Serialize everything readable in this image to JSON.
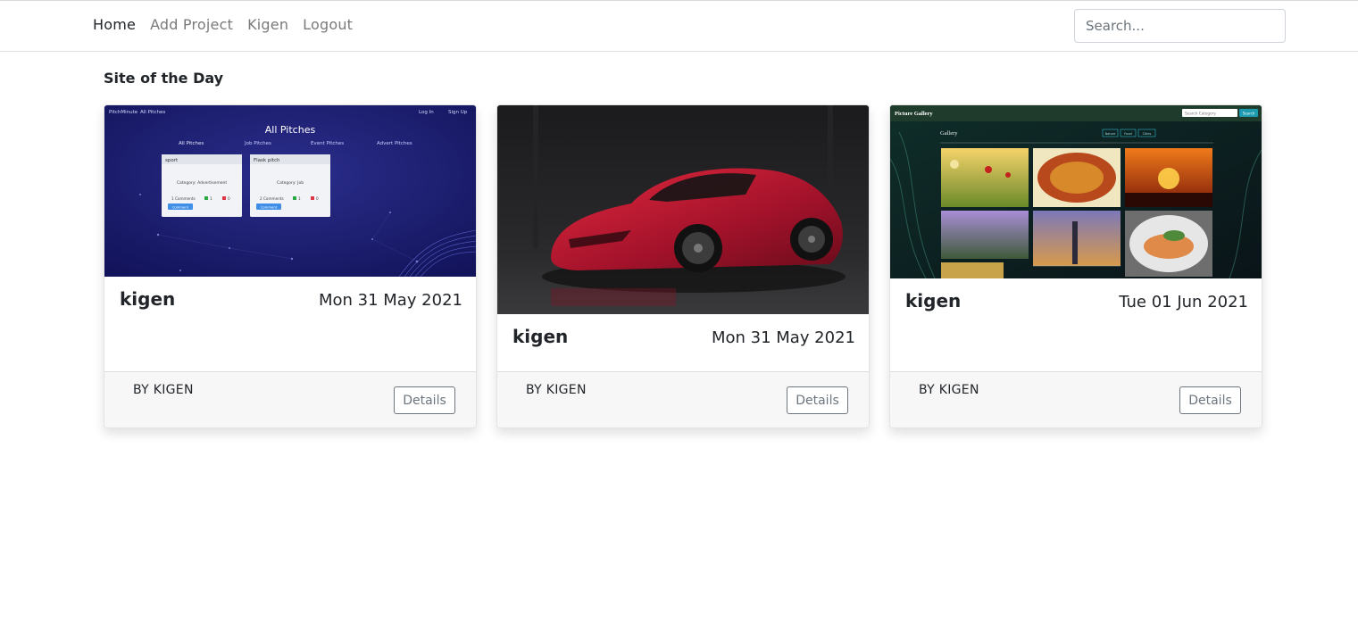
{
  "nav": {
    "links": [
      "Home",
      "Add Project",
      "Kigen",
      "Logout"
    ],
    "search_placeholder": "Search..."
  },
  "section_title": "Site of the Day",
  "cards": [
    {
      "title": "kigen",
      "date": "Mon 31 May 2021",
      "byline": "BY KIGEN",
      "button": "Details",
      "screenshot": {
        "brand": "PitchMinute",
        "menu": "All Pitches",
        "login": "Log In",
        "signup": "Sign Up",
        "heading": "All Pitches",
        "tabs": [
          "All Pitches",
          "Job Pitches",
          "Event Pitches",
          "Advert Pitches"
        ],
        "pitches": [
          {
            "title": "sport",
            "category": "Category: Advertisement",
            "comments": "1 Comments",
            "up": "1",
            "down": "0",
            "btn": "Comment"
          },
          {
            "title": "Flask pitch",
            "category": "Category: Job",
            "comments": "2 Comments",
            "up": "1",
            "down": "0",
            "btn": "Comment"
          }
        ]
      }
    },
    {
      "title": "kigen",
      "date": "Mon 31 May 2021",
      "byline": "BY KIGEN",
      "button": "Details"
    },
    {
      "title": "kigen",
      "date": "Tue 01 Jun 2021",
      "byline": "BY KIGEN",
      "button": "Details",
      "screenshot": {
        "brand": "Picture Gallery",
        "search_placeholder": "Search Category",
        "search_btn": "Search",
        "heading": "Gallery",
        "filters": [
          "Nature",
          "Food",
          "Cities"
        ]
      }
    }
  ]
}
